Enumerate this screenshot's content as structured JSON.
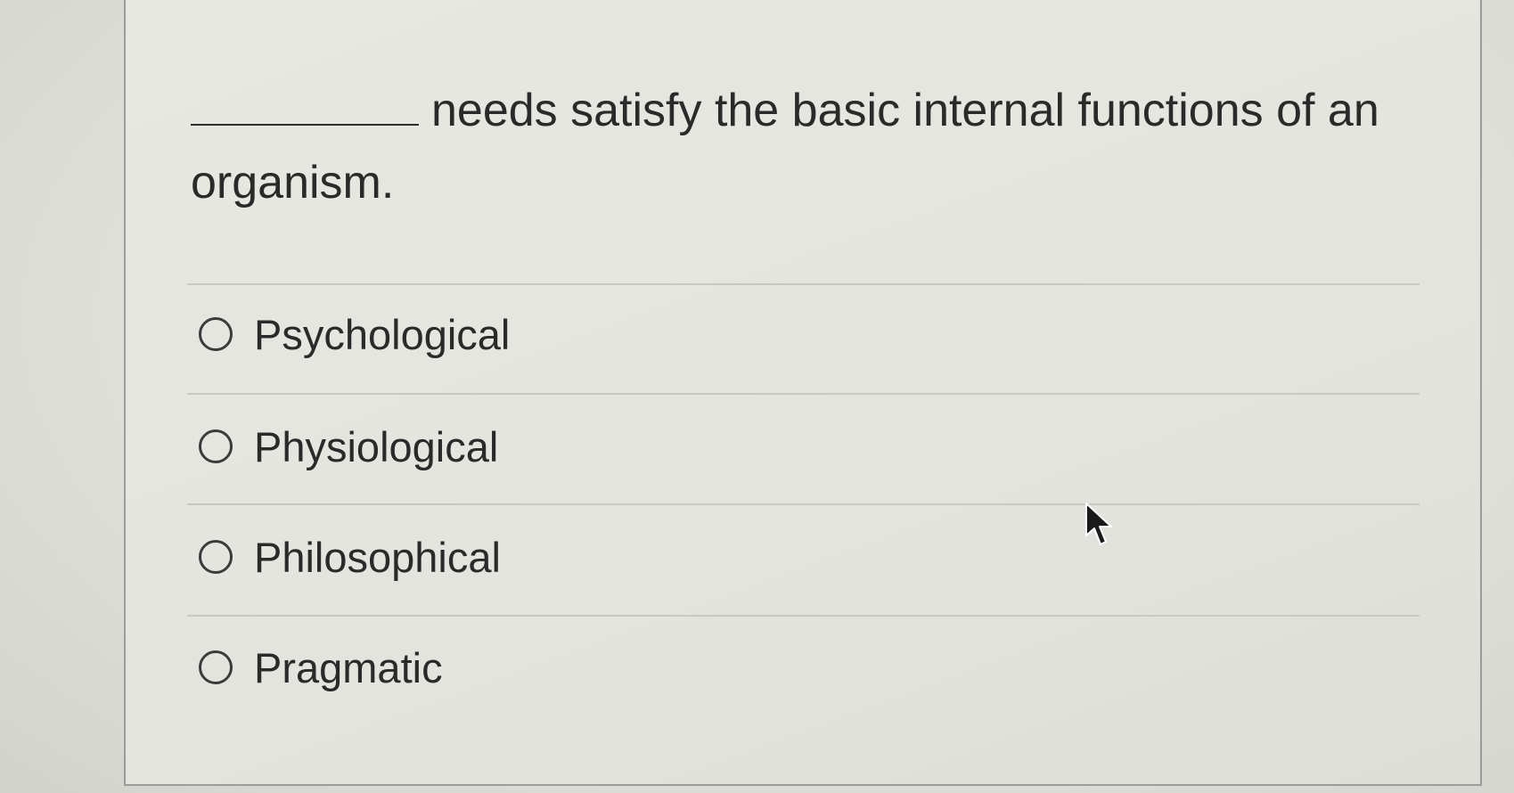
{
  "question": {
    "blank": "__________",
    "text": "needs satisfy the basic internal functions of an organism."
  },
  "options": [
    {
      "label": "Psychological",
      "selected": false
    },
    {
      "label": "Physiological",
      "selected": false
    },
    {
      "label": "Philosophical",
      "selected": false
    },
    {
      "label": "Pragmatic",
      "selected": false
    }
  ],
  "icons": {
    "cursor": "mouse-pointer-icon",
    "radio": "radio-button-icon"
  }
}
